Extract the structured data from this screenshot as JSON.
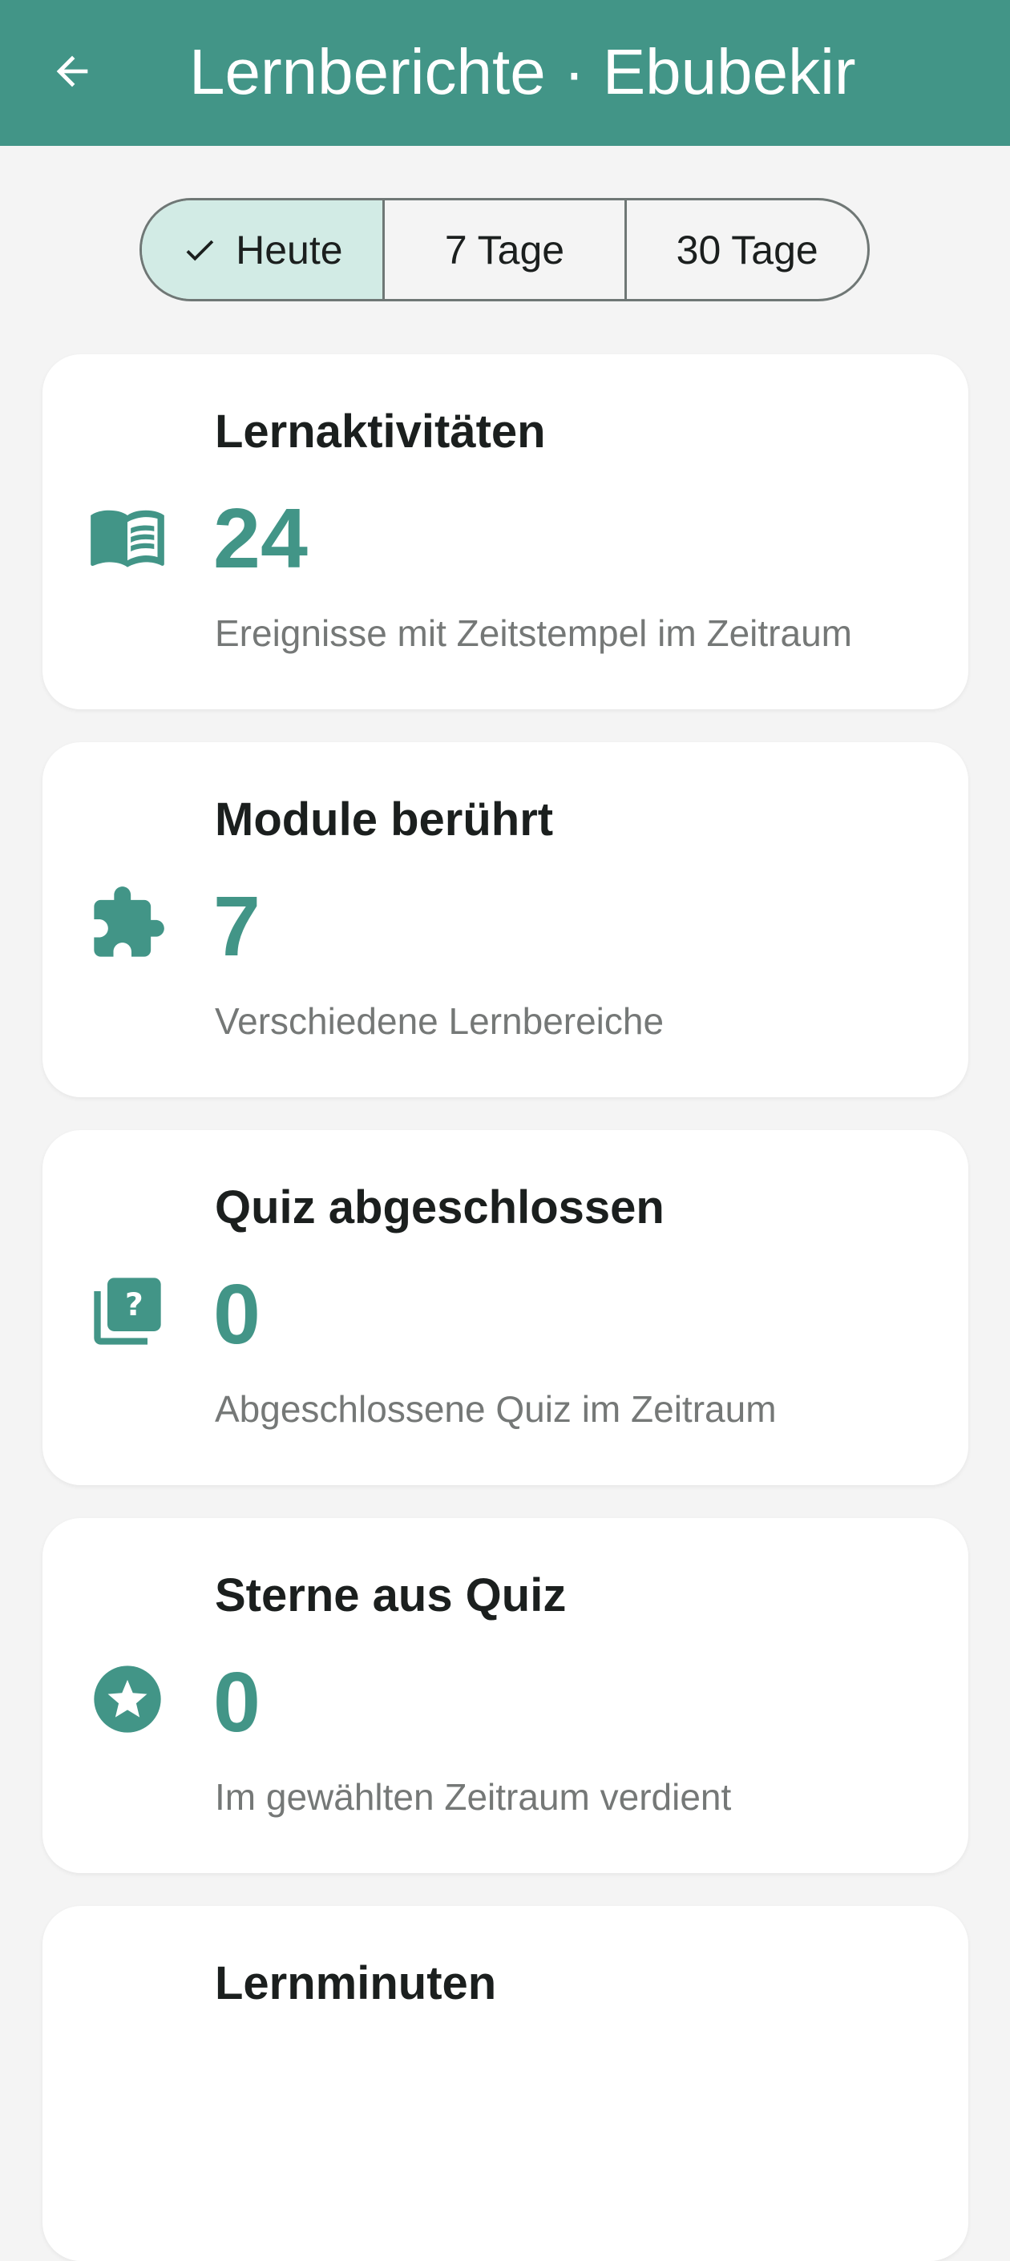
{
  "appbar": {
    "title": "Lernberichte · Ebubekir",
    "back_icon": "arrow-back-icon",
    "background": "#429587"
  },
  "period_selector": {
    "selected": "Heute",
    "options": [
      {
        "label": "Heute"
      },
      {
        "label": "7 Tage"
      },
      {
        "label": "30 Tage"
      }
    ]
  },
  "cards": [
    {
      "icon": "open-book-icon",
      "title": "Lernaktivitäten",
      "value": "24",
      "subtitle": "Ereignisse mit Zeitstempel im Zeitraum"
    },
    {
      "icon": "puzzle-piece-icon",
      "title": "Module berührt",
      "value": "7",
      "subtitle": "Verschiedene Lernbereiche"
    },
    {
      "icon": "quiz-icon",
      "title": "Quiz abgeschlossen",
      "value": "0",
      "subtitle": "Abgeschlossene Quiz im Zeitraum"
    },
    {
      "icon": "star-circle-icon",
      "title": "Sterne aus Quiz",
      "value": "0",
      "subtitle": "Im gewählten Zeitraum verdient"
    },
    {
      "icon": "",
      "title": "Lernminuten",
      "value": "",
      "subtitle": ""
    }
  ],
  "colors": {
    "accent": "#429587",
    "selected_segment": "#d2ebe5",
    "background": "#f4f4f4",
    "card": "#ffffff"
  }
}
